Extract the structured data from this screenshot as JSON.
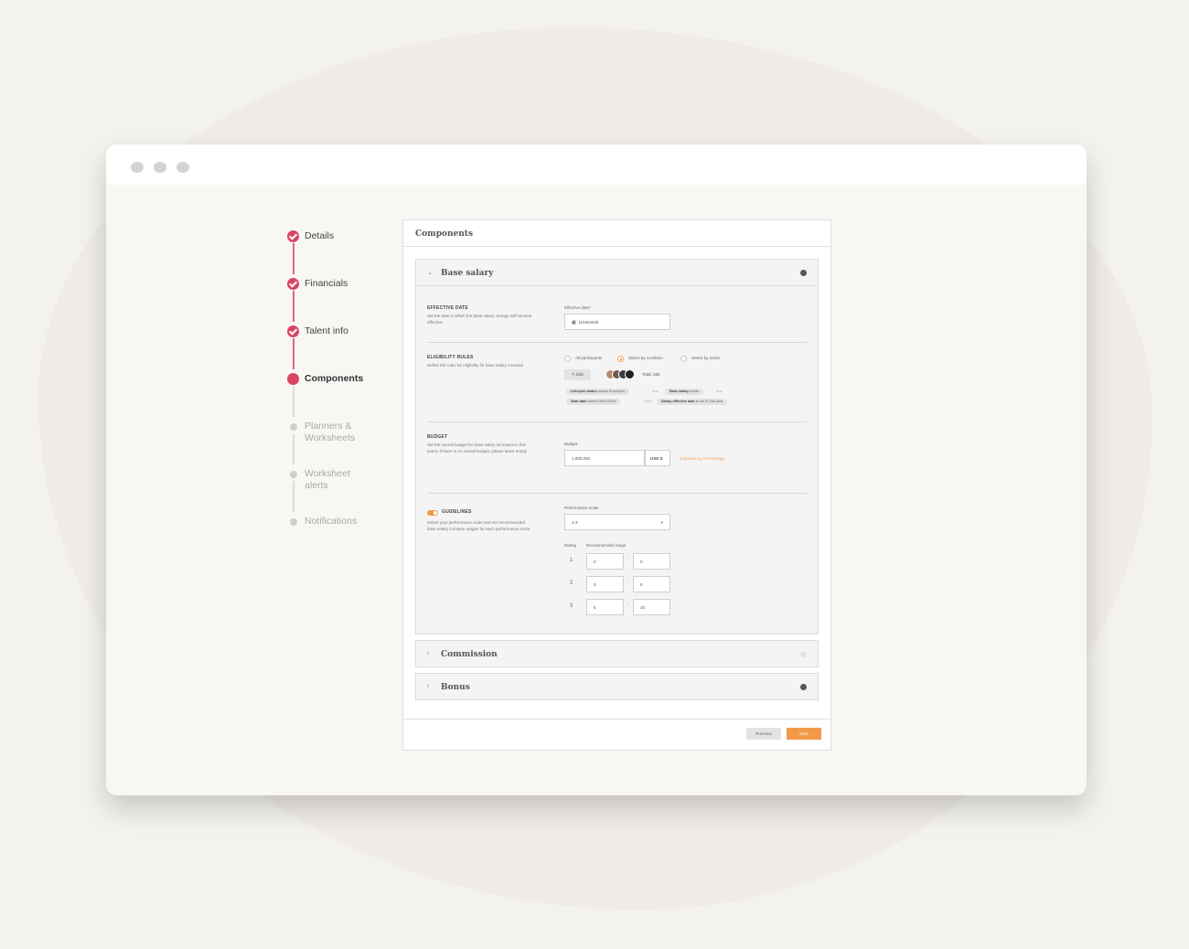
{
  "stepper": {
    "steps": [
      {
        "label": "Details",
        "state": "done"
      },
      {
        "label": "Financials",
        "state": "done"
      },
      {
        "label": "Talent info",
        "state": "done"
      },
      {
        "label": "Components",
        "state": "active"
      },
      {
        "label": "Planners &",
        "label2": "Worksheets",
        "state": "todo"
      },
      {
        "label": "Worksheet",
        "label2": "alerts",
        "state": "todo"
      },
      {
        "label": "Notifications",
        "state": "todo"
      }
    ]
  },
  "card": {
    "title": "Components",
    "base_salary": {
      "title": "Base salary",
      "effective_date": {
        "title": "EFFECTIVE DATE",
        "desc": "Set the date in which the base salary change will become effective",
        "field_label": "Effective date*",
        "value": "11/06/2025"
      },
      "eligibility": {
        "title": "ELIGIBILITY RULES",
        "desc": "Define the rules for eligibility for base salary increase",
        "options": [
          "All participants",
          "Select by condition",
          "Select by name"
        ],
        "selected": "Select by condition",
        "edit_label": "Edit",
        "total": "Total: 265",
        "chips": [
          {
            "k": "Lifecycle status",
            "v": "equals Employed"
          },
          {
            "k": "Base salary",
            "v": "exists"
          },
          {
            "k": "Start date",
            "v": "before 05/01/2025"
          },
          {
            "k": "Salary effective date",
            "v": "is not in This year"
          }
        ],
        "and": "And"
      },
      "budget": {
        "title": "BUDGET",
        "desc": "Set the overall budget for base salary increases in this event. If there is no overall budget, please leave empty",
        "field_label": "Budget",
        "value": "1,000,000",
        "currency": "USD $",
        "calc_link": "Calculate by Percentage"
      },
      "guidelines": {
        "title": "GUIDELINES",
        "enabled": true,
        "desc": "Select your performance scale and set recommended base salary increase ranges for each performance score",
        "scale_label": "Performance scale",
        "scale_value": "1-3",
        "rating_label": "Rating",
        "range_label": "Recommended range",
        "rows": [
          {
            "rating": "1",
            "min": "0",
            "max": "0"
          },
          {
            "rating": "2",
            "min": "0",
            "max": "5"
          },
          {
            "rating": "3",
            "min": "5",
            "max": "10"
          }
        ],
        "dash": "-"
      }
    },
    "commission": {
      "title": "Commission"
    },
    "bonus": {
      "title": "Bonus"
    },
    "prev_label": "Previous",
    "next_label": "Next"
  },
  "colors": {
    "accent_red": "#d94560",
    "accent_orange": "#f29a4a"
  }
}
